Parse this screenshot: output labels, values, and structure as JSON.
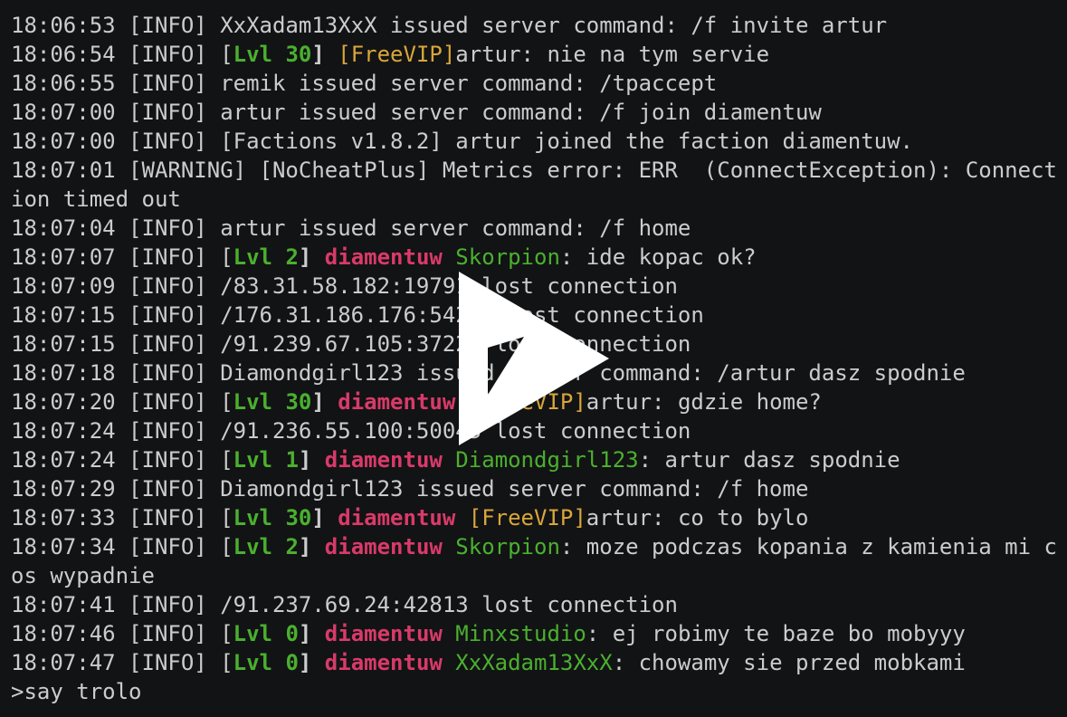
{
  "lines": [
    {
      "t": "18:06:53 [INFO] XxXadam13XxX issued server command: /f invite artur"
    },
    {
      "ts": "18:06:54 [INFO] ",
      "lvl": "Lvl 30",
      "vip": "[FreeVIP]",
      "msg": "artur: nie na tym servie"
    },
    {
      "t": "18:06:55 [INFO] remik issued server command: /tpaccept"
    },
    {
      "t": "18:07:00 [INFO] artur issued server command: /f join diamentuw"
    },
    {
      "t": "18:07:00 [INFO] [Factions v1.8.2] artur joined the faction diamentuw."
    },
    {
      "t": "18:07:01 [WARNING] [NoCheatPlus] Metrics error: ERR  (ConnectException): Connect"
    },
    {
      "t": "ion timed out"
    },
    {
      "t": "18:07:04 [INFO] artur issued server command: /f home"
    },
    {
      "ts": "18:07:07 [INFO] ",
      "lvl": "Lvl 2",
      "fac": "diamentuw",
      "name": "Skorpion",
      "msg": ": ide kopac ok?"
    },
    {
      "t": "18:07:09 [INFO] /83.31.58.182:19791 lost connection"
    },
    {
      "t": "18:07:15 [INFO] /176.31.186.176:54210 lost connection"
    },
    {
      "t": "18:07:15 [INFO] /91.239.67.105:37222 lost connection"
    },
    {
      "t": "18:07:18 [INFO] Diamondgirl123 issued server command: /artur dasz spodnie"
    },
    {
      "ts": "18:07:20 [INFO] ",
      "lvl": "Lvl 30",
      "fac": "diamentuw",
      "vip": "[FreeVIP]",
      "msg": "artur: gdzie home?"
    },
    {
      "t": "18:07:24 [INFO] /91.236.55.100:50045 lost connection"
    },
    {
      "ts": "18:07:24 [INFO] ",
      "lvl": "Lvl 1",
      "fac": "diamentuw",
      "name": "Diamondgirl123",
      "msg": ": artur dasz spodnie"
    },
    {
      "t": "18:07:29 [INFO] Diamondgirl123 issued server command: /f home"
    },
    {
      "ts": "18:07:33 [INFO] ",
      "lvl": "Lvl 30",
      "fac": "diamentuw",
      "vip": "[FreeVIP]",
      "msg": "artur: co to bylo"
    },
    {
      "ts": "18:07:34 [INFO] ",
      "lvl": "Lvl 2",
      "fac": "diamentuw",
      "name": "Skorpion",
      "msg": ": moze podczas kopania z kamienia mi c"
    },
    {
      "t": "os wypadnie"
    },
    {
      "t": "18:07:41 [INFO] /91.237.69.24:42813 lost connection"
    },
    {
      "ts": "18:07:46 [INFO] ",
      "lvl": "Lvl 0",
      "fac": "diamentuw",
      "name": "Minxstudio",
      "msg": ": ej robimy te baze bo mobyyy"
    },
    {
      "ts": "18:07:47 [INFO] ",
      "lvl": "Lvl 0",
      "fac": "diamentuw",
      "name": "XxXadam13XxX",
      "msg": ": chowamy sie przed mobkami"
    }
  ],
  "prompt": ">say trolo",
  "colors": {
    "background": "#121314",
    "text": "#cccccc",
    "level": "#4ab02f",
    "faction": "#d93a6a",
    "player": "#4ab02f",
    "vip": "#d9a63a",
    "play_icon": "#ffffff"
  },
  "overlay_icon": "play-icon"
}
